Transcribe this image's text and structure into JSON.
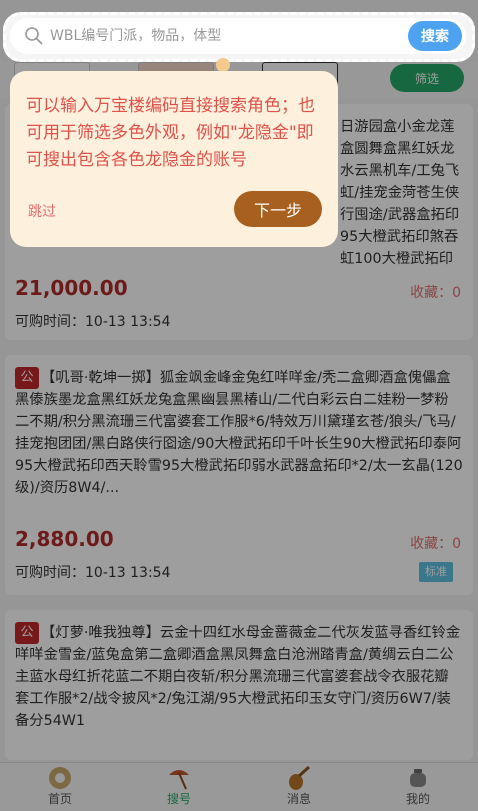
{
  "search": {
    "placeholder": "WBL编号门派，物品，体型",
    "button_label": "搜索"
  },
  "filter": {
    "button_label": "筛选"
  },
  "guide": {
    "text": "可以输入万宝楼编码直接搜索角色；也可用于筛选多色外观，例如\"龙隐金\"即可搜出包含各色龙隐金的账号",
    "skip_label": "跳过",
    "next_label": "下一步"
  },
  "listings": [
    {
      "description": "日游园盒小金龙莲盒圆舞盒黑红妖龙水云黑机车/工兔飞虹/挂宠金菏苍生侠行囤途/武器盒拓印95大橙武拓印煞吞虹100大橙武拓印神威110...",
      "price": "21,000.00",
      "favorites": "收藏：0",
      "time": "可购时间：10-13 13:54"
    },
    {
      "tag": "公",
      "description": "【叽哥·乾坤一掷】狐金飒金峰金兔红咩咩金/秃二盒卿酒盒傀儡盒黑傣族墨龙盒黑红妖龙兔盒黑幽昙黑椿山/二代白彩云白二娃粉一梦粉二不期/积分黑流珊三代富婆套工作服*6/特效万川黛瑾玄苍/狼头/飞马/挂宠抱团团/黑白路侠行囵途/90大橙武拓印千叶长生90大橙武拓印泰阿95大橙武拓印西天聆雪95大橙武拓印弱水武器盒拓印*2/太一玄晶(120级)/资历8W4/...",
      "price": "2,880.00",
      "favorites": "收藏：0",
      "time": "可购时间：10-13 13:54",
      "badge": "标准"
    },
    {
      "tag": "公",
      "description": "【灯萝·唯我独尊】云金十四红水母金蔷薇金二代灰发蓝寻香红铃金咩咩金雪金/蓝兔盒第二盒卿酒盒黑凤舞盒白沧洲踏青盒/黄绸云白二公主蓝水母红折花蓝二不期白夜斩/积分黑流珊三代富婆套战令衣服花瓣套工作服*2/战令披风*2/兔江湖/95大橙武拓印玉女守门/资历6W7/装备分54W1"
    }
  ],
  "tabbar": {
    "items": [
      {
        "label": "首页",
        "icon": "coin-icon"
      },
      {
        "label": "搜号",
        "icon": "umbrella-icon"
      },
      {
        "label": "消息",
        "icon": "pipa-icon"
      },
      {
        "label": "我的",
        "icon": "pot-icon"
      }
    ]
  },
  "colors": {
    "accent_blue": "#4da3f0",
    "filter_green": "#26a968",
    "price_red": "#b02a2a",
    "next_brown": "#a7601f",
    "tip_bg": "#fdf0dd"
  }
}
